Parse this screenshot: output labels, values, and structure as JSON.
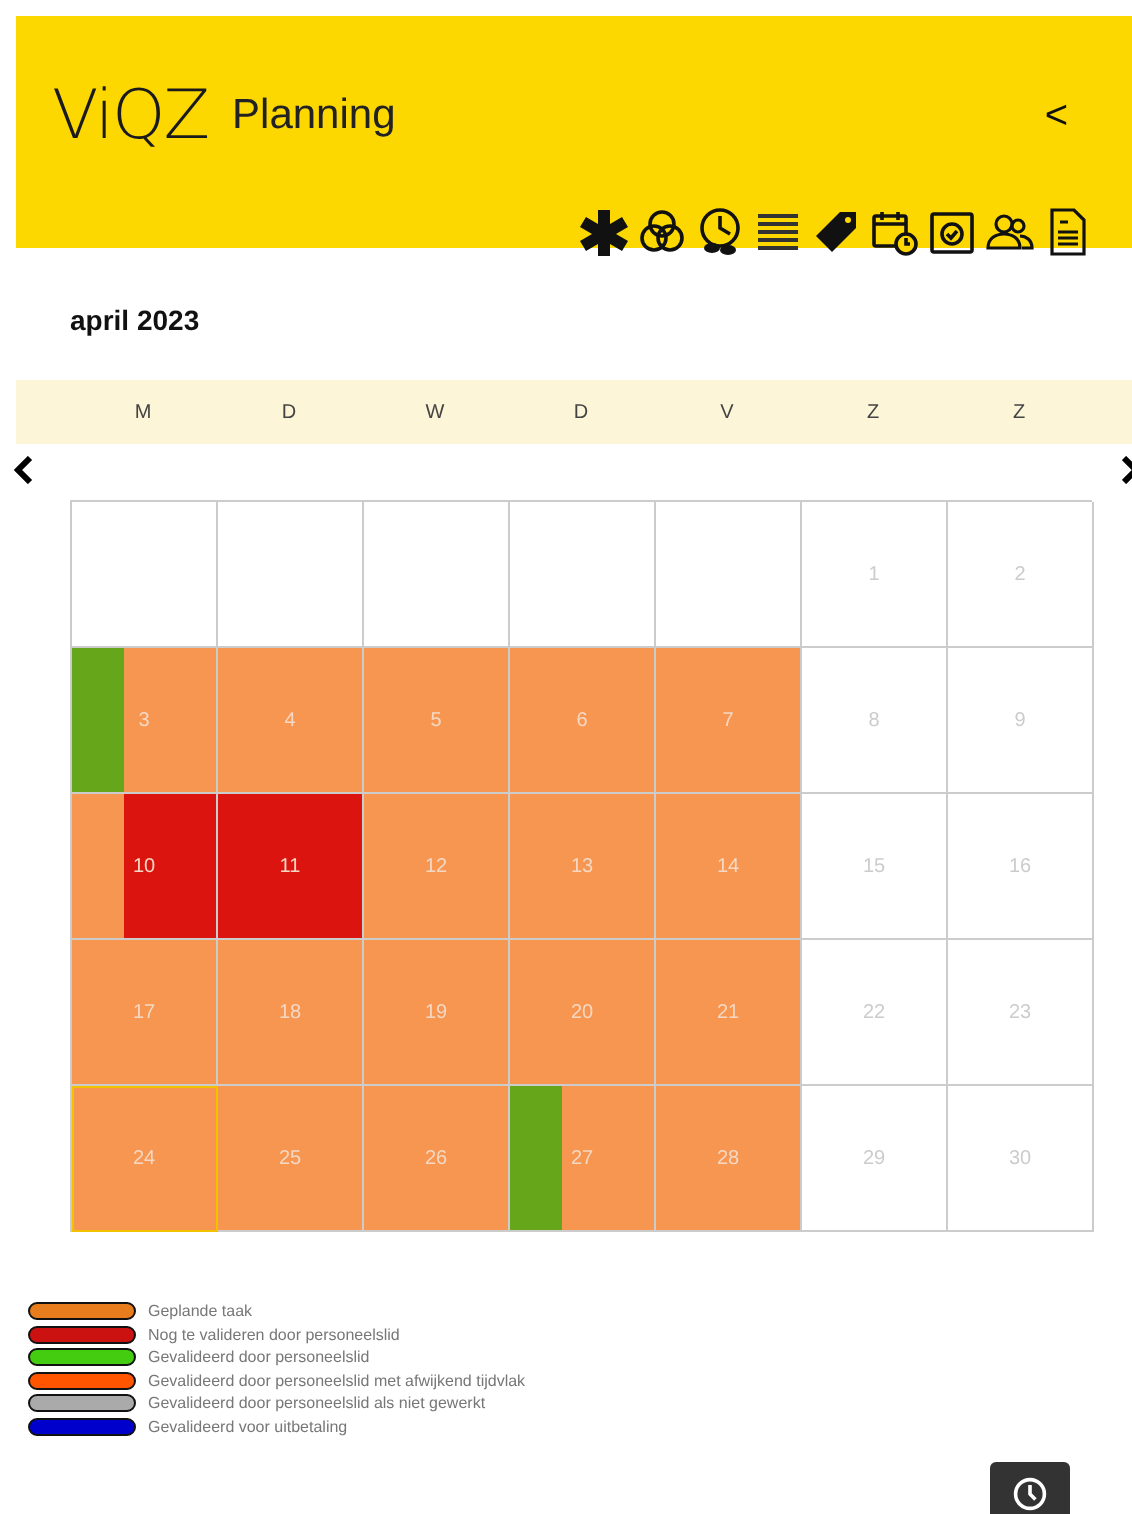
{
  "header": {
    "logo": "ViQZ",
    "title": "Planning",
    "back": "<"
  },
  "month": "april 2023",
  "weekdays": [
    "M",
    "D",
    "W",
    "D",
    "V",
    "Z",
    "Z"
  ],
  "weeks": [
    [
      {
        "kind": "empty"
      },
      {
        "kind": "empty"
      },
      {
        "kind": "empty"
      },
      {
        "kind": "empty"
      },
      {
        "kind": "empty"
      },
      {
        "kind": "day",
        "day": "1",
        "selected": false
      },
      {
        "kind": "day",
        "day": "2",
        "selected": false
      }
    ],
    [
      {
        "kind": "day",
        "day": "3",
        "color": "#f79650",
        "stripe": {
          "color": "#66a61a"
        },
        "selected": false
      },
      {
        "kind": "day",
        "day": "4",
        "color": "#f79650",
        "selected": false
      },
      {
        "kind": "day",
        "day": "5",
        "color": "#f79650",
        "selected": false
      },
      {
        "kind": "day",
        "day": "6",
        "color": "#f79650",
        "selected": false
      },
      {
        "kind": "day",
        "day": "7",
        "color": "#f79650",
        "selected": false
      },
      {
        "kind": "day",
        "day": "8",
        "selected": false
      },
      {
        "kind": "day",
        "day": "9",
        "selected": false
      }
    ],
    [
      {
        "kind": "day",
        "day": "10",
        "color": "#db1410",
        "stripe": {
          "color": "#f79650"
        },
        "selected": false
      },
      {
        "kind": "day",
        "day": "11",
        "color": "#db1410",
        "selected": false
      },
      {
        "kind": "day",
        "day": "12",
        "color": "#f79650",
        "selected": false
      },
      {
        "kind": "day",
        "day": "13",
        "color": "#f79650",
        "selected": false
      },
      {
        "kind": "day",
        "day": "14",
        "color": "#f79650",
        "selected": false
      },
      {
        "kind": "day",
        "day": "15",
        "selected": false
      },
      {
        "kind": "day",
        "day": "16",
        "selected": false
      }
    ],
    [
      {
        "kind": "day",
        "day": "17",
        "color": "#f79650",
        "selected": false
      },
      {
        "kind": "day",
        "day": "18",
        "color": "#f79650",
        "selected": false
      },
      {
        "kind": "day",
        "day": "19",
        "color": "#f79650",
        "selected": false
      },
      {
        "kind": "day",
        "day": "20",
        "color": "#f79650",
        "selected": false
      },
      {
        "kind": "day",
        "day": "21",
        "color": "#f79650",
        "selected": false
      },
      {
        "kind": "day",
        "day": "22",
        "selected": false
      },
      {
        "kind": "day",
        "day": "23",
        "selected": false
      }
    ],
    [
      {
        "kind": "day",
        "day": "24",
        "color": "#f79650",
        "selected": true
      },
      {
        "kind": "day",
        "day": "25",
        "color": "#f79650",
        "selected": false
      },
      {
        "kind": "day",
        "day": "26",
        "color": "#f79650",
        "selected": false
      },
      {
        "kind": "day",
        "day": "27",
        "color": "#f79650",
        "stripe": {
          "color": "#66a61a"
        },
        "selected": false
      },
      {
        "kind": "day",
        "day": "28",
        "color": "#f79650",
        "selected": false
      },
      {
        "kind": "day",
        "day": "29",
        "selected": false
      },
      {
        "kind": "day",
        "day": "30",
        "selected": false
      }
    ]
  ],
  "legend": [
    {
      "color": "#e87d1e",
      "label": "Geplande taak"
    },
    {
      "color": "#cc1111",
      "label": "Nog te valideren door personeelslid"
    },
    {
      "color": "#44cc11",
      "label": "Gevalideerd door personeelslid"
    },
    {
      "color": "#ff5500",
      "label": "Gevalideerd door personeelslid met afwijkend tijdvlak"
    },
    {
      "color": "#aaaaaa",
      "label": "Gevalideerd door personeelslid als niet gewerkt"
    },
    {
      "color": "#0000cc",
      "label": "Gevalideerd voor uitbetaling"
    }
  ]
}
